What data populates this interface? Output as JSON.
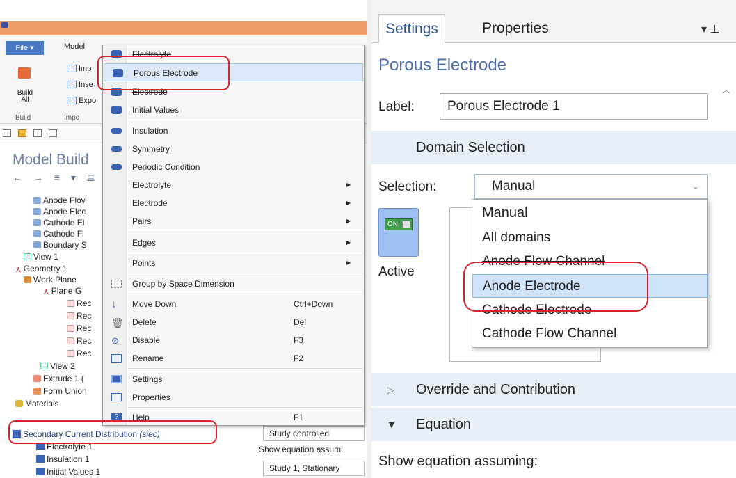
{
  "left": {
    "ribbon": {
      "file_label": "File ▾",
      "model_tab": "Model",
      "build_label": "Build All",
      "build_group": "Build",
      "import_group": "Impo",
      "items": [
        "Imp",
        "Inse",
        "Expo"
      ]
    },
    "model_builder_title": "Model Build",
    "tree": [
      "Anode Flov",
      "Anode Elec",
      "Cathode El",
      "Cathode Fl",
      "Boundary S",
      "View 1",
      "Geometry 1",
      "Work Plane",
      "Plane G",
      "Rec",
      "Rec",
      "Rec",
      "Rec",
      "Rec",
      "View 2",
      "Extrude 1 (",
      "Form Union",
      "Materials"
    ],
    "physics_label": "Secondary Current Distribution",
    "physics_tag": "(siec)",
    "physics_children": [
      "Electrolyte 1",
      "Insulation 1",
      "Initial Values 1"
    ],
    "study_controlled": "Study controlled",
    "show_eq_left": "Show equation assumi",
    "study_stationary": "Study 1, Stationary"
  },
  "context_menu": {
    "items": [
      {
        "label": "Electrolyte",
        "icon": "domain-icon",
        "strike": true
      },
      {
        "label": "Porous Electrode",
        "icon": "domain-icon",
        "hover": true
      },
      {
        "label": "Electrode",
        "icon": "domain-icon",
        "strike": true
      },
      {
        "label": "Initial Values",
        "icon": "domain-icon"
      },
      {
        "label": "Insulation",
        "icon": "boundary-icon"
      },
      {
        "label": "Symmetry",
        "icon": "boundary-icon"
      },
      {
        "label": "Periodic Condition",
        "icon": "boundary-icon"
      },
      {
        "label": "Electrolyte",
        "submenu": true
      },
      {
        "label": "Electrode",
        "submenu": true
      },
      {
        "label": "Pairs",
        "submenu": true
      },
      {
        "label": "Edges",
        "submenu": true
      },
      {
        "label": "Points",
        "submenu": true
      },
      {
        "label": "Group by Space Dimension",
        "icon": "group-icon"
      },
      {
        "label": "Move Down",
        "shortcut": "Ctrl+Down",
        "icon": "arrow-down-icon"
      },
      {
        "label": "Delete",
        "shortcut": "Del",
        "icon": "trash-icon"
      },
      {
        "label": "Disable",
        "shortcut": "F3",
        "icon": "disable-icon"
      },
      {
        "label": "Rename",
        "shortcut": "F2",
        "icon": "rename-icon"
      },
      {
        "label": "Settings",
        "icon": "settings-icon"
      },
      {
        "label": "Properties",
        "icon": "properties-icon"
      },
      {
        "label": "Help",
        "shortcut": "F1",
        "icon": "help-icon"
      }
    ]
  },
  "right": {
    "tabs": [
      "Settings",
      "Properties"
    ],
    "pin_icons": "▾ ⊥",
    "title": "Porous Electrode",
    "label_key": "Label:",
    "label_value": "Porous Electrode 1",
    "domain_selection": "Domain Selection",
    "selection_key": "Selection:",
    "selection_value": "Manual",
    "toggle_text": "ON",
    "active_label": "Active",
    "options": [
      "Manual",
      "All domains",
      "Anode Flow Channel",
      "Anode Electrode",
      "Cathode Electrode",
      "Cathode Flow Channel"
    ],
    "selected_option": "Anode Electrode",
    "section_override": "Override and Contribution",
    "section_equation": "Equation",
    "show_equation": "Show equation assuming:"
  },
  "colors": {
    "accent": "#2f5597",
    "annotation_red": "#d9222a",
    "hover": "#dde9f8",
    "section_bg": "#e8eef7"
  }
}
